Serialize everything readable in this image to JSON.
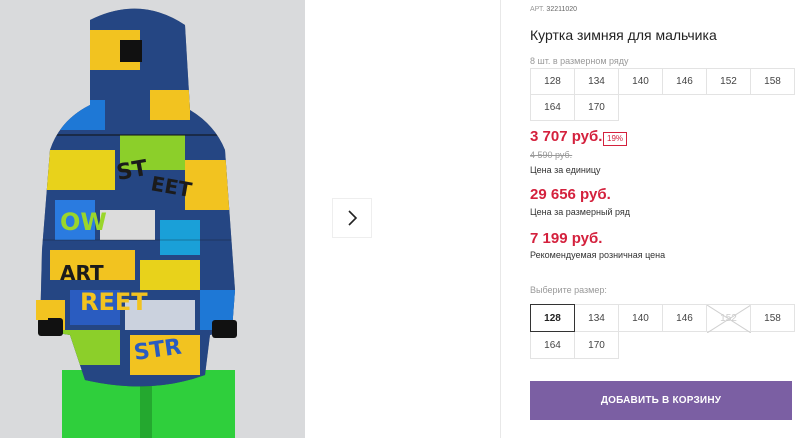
{
  "product": {
    "sku_label": "АРТ.",
    "sku": "32211020",
    "title": "Куртка зимняя для мальчика",
    "pack_note": "8 шт. в размерном ряду",
    "pack_sizes": [
      "128",
      "134",
      "140",
      "146",
      "152",
      "158",
      "164",
      "170"
    ]
  },
  "pricing": {
    "unit_price": "3 707 руб.",
    "discount_badge": "19%",
    "old_price": "4 590 руб.",
    "unit_label": "Цена за единицу",
    "pack_price": "29 656 руб.",
    "pack_label": "Цена за размерный ряд",
    "rrp_price": "7 199 руб.",
    "rrp_label": "Рекомендуемая розничная цена"
  },
  "size_selector": {
    "label": "Выберите размер:",
    "selected": "128",
    "options": [
      {
        "size": "128",
        "state": "selected"
      },
      {
        "size": "134",
        "state": "available"
      },
      {
        "size": "140",
        "state": "available"
      },
      {
        "size": "146",
        "state": "available"
      },
      {
        "size": "152",
        "state": "unavailable"
      },
      {
        "size": "158",
        "state": "available"
      },
      {
        "size": "164",
        "state": "available"
      },
      {
        "size": "170",
        "state": "available"
      }
    ]
  },
  "actions": {
    "add_to_cart": "Добавить в корзину"
  },
  "gallery": {
    "next_icon": "chevron-right-icon"
  },
  "colors": {
    "price_red": "#d4213d",
    "button_purple": "#7b5fa3",
    "photo_background": "#d9dadc",
    "pants_green": "#2fcf3c"
  }
}
